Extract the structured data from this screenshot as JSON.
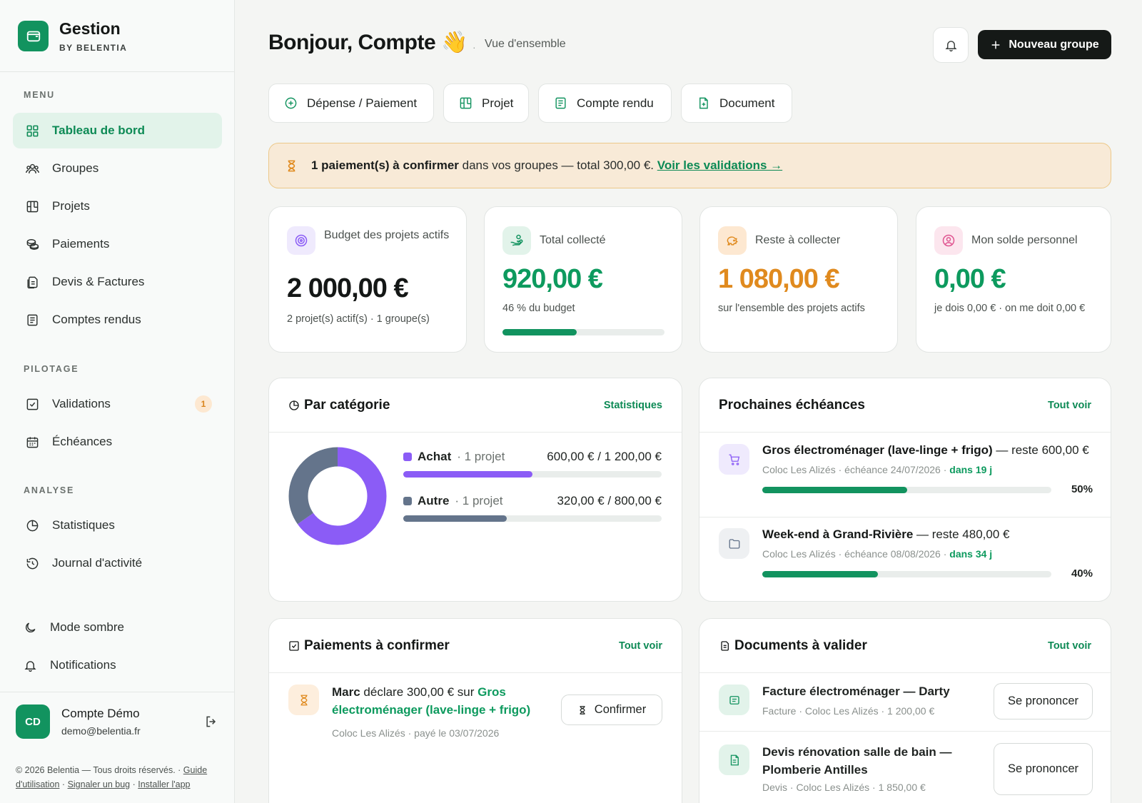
{
  "brand": {
    "name": "Gestion",
    "sub": "BY BELENTIA"
  },
  "sidebar": {
    "menu_title": "MENU",
    "menu": [
      {
        "label": "Tableau de bord",
        "icon": "grid-icon",
        "active": true
      },
      {
        "label": "Groupes",
        "icon": "users-icon"
      },
      {
        "label": "Projets",
        "icon": "kanban-icon"
      },
      {
        "label": "Paiements",
        "icon": "coins-icon"
      },
      {
        "label": "Devis & Factures",
        "icon": "files-icon"
      },
      {
        "label": "Comptes rendus",
        "icon": "notes-icon"
      }
    ],
    "pilotage_title": "PILOTAGE",
    "pilotage": [
      {
        "label": "Validations",
        "icon": "check-square-icon",
        "badge": "1"
      },
      {
        "label": "Échéances",
        "icon": "calendar-icon"
      }
    ],
    "analyse_title": "ANALYSE",
    "analyse": [
      {
        "label": "Statistiques",
        "icon": "pie-icon"
      },
      {
        "label": "Journal d'activité",
        "icon": "history-icon"
      }
    ],
    "extras": [
      {
        "label": "Mode sombre",
        "icon": "moon-icon"
      },
      {
        "label": "Notifications",
        "icon": "bell-icon"
      }
    ],
    "user": {
      "initials": "CD",
      "name": "Compte Démo",
      "email": "demo@belentia.fr"
    },
    "footer": {
      "copyright": "© 2026 Belentia — Tous droits réservés. · ",
      "guide": "Guide d'utilisation",
      "sep1": " · ",
      "bug": "Signaler un bug",
      "sep2": " · ",
      "install": "Installer l'app"
    }
  },
  "header": {
    "greeting": "Bonjour, Compte 👋",
    "crumb_sep": "·",
    "crumb": "Vue d'ensemble",
    "new_group": "Nouveau groupe"
  },
  "quick_actions": [
    {
      "label": "Dépense / Paiement",
      "icon": "plus-circle-icon"
    },
    {
      "label": "Projet",
      "icon": "kanban-icon"
    },
    {
      "label": "Compte rendu",
      "icon": "notes-icon"
    },
    {
      "label": "Document",
      "icon": "file-plus-icon"
    }
  ],
  "alert": {
    "strong": "1 paiement(s) à confirmer",
    "text": " dans vos groupes — total 300,00 €. ",
    "link": "Voir les validations →"
  },
  "stats": [
    {
      "label": "Budget des projets actifs",
      "value": "2 000,00 €",
      "sub": "2 projet(s) actif(s) · 1 groupe(s)",
      "color": "#141716",
      "icon": "target-icon",
      "icon_bg": "#efeafd",
      "icon_color": "#8b5cf6"
    },
    {
      "label": "Total collecté",
      "value": "920,00 €",
      "sub": "46 % du budget",
      "progress": 0.46,
      "color": "#0d9a5e",
      "icon": "hand-coins-icon",
      "icon_bg": "#e2f3ea",
      "icon_color": "#12935f"
    },
    {
      "label": "Reste à collecter",
      "value": "1 080,00 €",
      "sub": "sur l'ensemble des projets actifs",
      "color": "#e08a1e",
      "icon": "piggy-bank-icon",
      "icon_bg": "#fde8d1",
      "icon_color": "#e08a1e"
    },
    {
      "label": "Mon solde personnel",
      "value": "0,00 €",
      "sub": "je dois 0,00 € · on me doit 0,00 €",
      "color": "#0d9a5e",
      "icon": "user-circle-icon",
      "icon_bg": "#fce6ee",
      "icon_color": "#e05591"
    }
  ],
  "categories": {
    "title": "Par catégorie",
    "link": "Statistiques",
    "items": [
      {
        "name": "Achat",
        "count": " · 1 projet",
        "amount": "600,00 € / 1 200,00 €",
        "progress": 0.5,
        "color": "#8b5cf6"
      },
      {
        "name": "Autre",
        "count": " · 1 projet",
        "amount": "320,00 € / 800,00 €",
        "progress": 0.4,
        "color": "#64748b"
      }
    ],
    "donut": [
      {
        "value": 600,
        "color": "#8b5cf6"
      },
      {
        "value": 320,
        "color": "#64748b"
      }
    ]
  },
  "due": {
    "title": "Prochaines échéances",
    "link": "Tout voir",
    "items": [
      {
        "name": "Gros électroménager (lave-linge + frigo)",
        "rest": " — reste 600,00 €",
        "meta": "Coloc Les Alizés · échéance 24/07/2026 · ",
        "days": "dans 19 j",
        "pct": "50%",
        "progress": 0.5,
        "icon": "cart-icon",
        "icon_bg": "#efeafd",
        "icon_color": "#8b5cf6"
      },
      {
        "name": "Week-end à Grand-Rivière",
        "rest": " — reste 480,00 €",
        "meta": "Coloc Les Alizés · échéance 08/08/2026 · ",
        "days": "dans 34 j",
        "pct": "40%",
        "progress": 0.4,
        "icon": "folder-icon",
        "icon_bg": "#eef0f2",
        "icon_color": "#64748b"
      }
    ]
  },
  "payments": {
    "title": "Paiements à confirmer",
    "link": "Tout voir",
    "item": {
      "who": "Marc",
      "text": " déclare 300,00 € sur ",
      "project": "Gros électroménager (lave-linge + frigo)",
      "meta": "Coloc Les Alizés · payé le 03/07/2026",
      "button": "Confirmer"
    }
  },
  "documents": {
    "title": "Documents à valider",
    "link": "Tout voir",
    "items": [
      {
        "title": "Facture électroménager — Darty",
        "meta": "Facture · Coloc Les Alizés · 1 200,00 €",
        "button": "Se prononcer",
        "icon": "receipt-icon"
      },
      {
        "title": "Devis rénovation salle de bain — Plomberie Antilles",
        "meta": "Devis · Coloc Les Alizés · 1 850,00 €",
        "button": "Se prononcer",
        "icon": "file-icon"
      }
    ]
  }
}
